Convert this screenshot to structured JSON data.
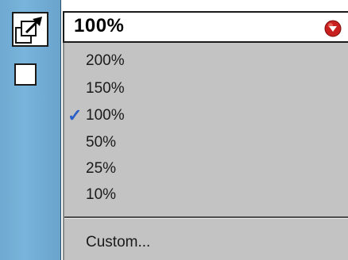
{
  "zoom": {
    "value": "100%",
    "arrow_color": "#c8201e"
  },
  "menu": {
    "items": [
      {
        "label": "200%",
        "checked": false
      },
      {
        "label": "150%",
        "checked": false
      },
      {
        "label": "100%",
        "checked": true
      },
      {
        "label": "50%",
        "checked": false
      },
      {
        "label": "25%",
        "checked": false
      },
      {
        "label": "10%",
        "checked": false
      }
    ],
    "check_mark": "✓",
    "custom_label": "Custom..."
  },
  "icons": {
    "zoom_tool": "zoom-arrow-icon",
    "square_tool": "square-icon",
    "dropdown": "dropdown-arrow-icon"
  }
}
